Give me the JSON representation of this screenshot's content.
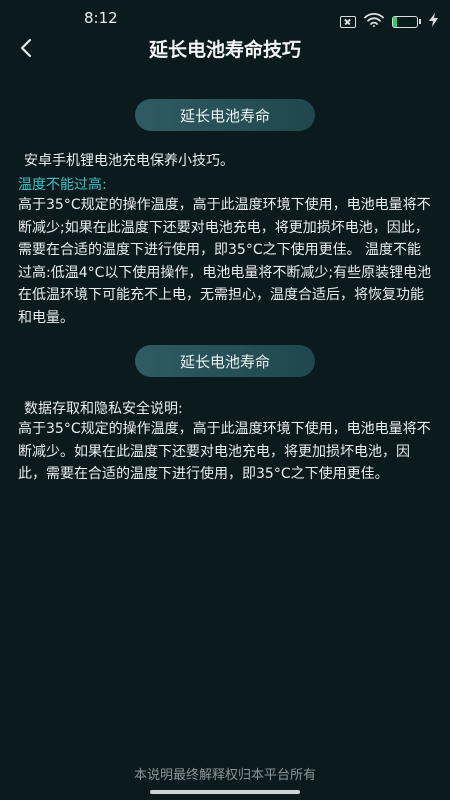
{
  "status_bar": {
    "time": "8:12",
    "battery_level": "16",
    "battery_fraction": 0.16,
    "icons": [
      "sim-card-off-icon",
      "wifi-icon",
      "battery-icon",
      "charging-bolt-icon"
    ]
  },
  "header": {
    "back_icon": "chevron-left-icon",
    "title": "延长电池寿命技巧"
  },
  "sections": [
    {
      "pill_label": "延长电池寿命",
      "intro": "安卓手机锂电池充电保养小技巧。",
      "subheading": "温度不能过高:",
      "body": "高于35°C规定的操作温度，高于此温度环境下使用，电池电量将不断减少;如果在此温度下还要对电池充电，将更加损坏电池，因此，需要在合适的温度下进行使用，即35°C之下使用更佳。 温度不能过高:低温4°C以下使用操作，电池电量将不断减少;有些原装锂电池在低温环境下可能充不上电，无需担心，温度合适后，将恢复功能和电量。"
    },
    {
      "pill_label": "延长电池寿命",
      "intro": "数据存取和隐私安全说明:",
      "body": "高于35°C规定的操作温度，高于此温度环境下使用，电池电量将不断减少。如果在此温度下还要对电池充电，将更加损坏电池，因此，需要在合适的温度下进行使用，即35°C之下使用更佳。"
    }
  ],
  "footer": {
    "note": "本说明最终解释权归本平台所有"
  },
  "colors": {
    "background": "#0b1a1d",
    "accent": "#37c3c7",
    "pill": "#2f5b63",
    "battery_fill": "#2ecc71"
  }
}
